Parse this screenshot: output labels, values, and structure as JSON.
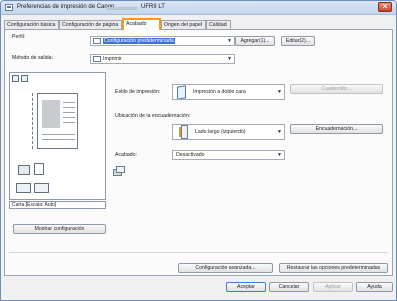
{
  "window": {
    "title": "Preferencias de impresión de Canon",
    "title_suffix": "UFRII LT",
    "close_glyph": "✕"
  },
  "tabs": [
    {
      "label": "Configuración básica",
      "active": false
    },
    {
      "label": "Configuración de página",
      "active": false
    },
    {
      "label": "Acabado",
      "active": true
    },
    {
      "label": "Origen del papel",
      "active": false
    },
    {
      "label": "Calidad",
      "active": false
    }
  ],
  "profile": {
    "label": "Perfil:",
    "value": "Configuración predeterminada",
    "add_button": "Agregar(1)...",
    "edit_button": "Editar(2)..."
  },
  "output_method": {
    "label": "Método de salida:",
    "value": "Imprimir"
  },
  "preview": {
    "caption": "Carta [Escala: Auto]",
    "show_settings_button": "Mostrar configuración"
  },
  "print_style": {
    "label": "Estilo de impresión:",
    "value": "Impresión a doble cara",
    "booklet_button": "Cuadernillo..."
  },
  "binding": {
    "label": "Ubicación de la encuadernación:",
    "value": "Lado largo (izquierdo)",
    "binding_button": "Encuadernación..."
  },
  "finishing": {
    "label": "Acabado:",
    "value": "Desactivado"
  },
  "advanced_button": "Configuración avanzada...",
  "restore_button": "Restaurar las opciones predeterminadas",
  "footer": {
    "ok": "Aceptar",
    "cancel": "Cancelar",
    "apply": "Aplicar",
    "help": "Ayuda"
  },
  "colors": {
    "accent_highlight": "#3874d0",
    "active_tab_border": "#f59a1a",
    "title_bar": "#c2d4ec",
    "close_button": "#c8432a"
  }
}
